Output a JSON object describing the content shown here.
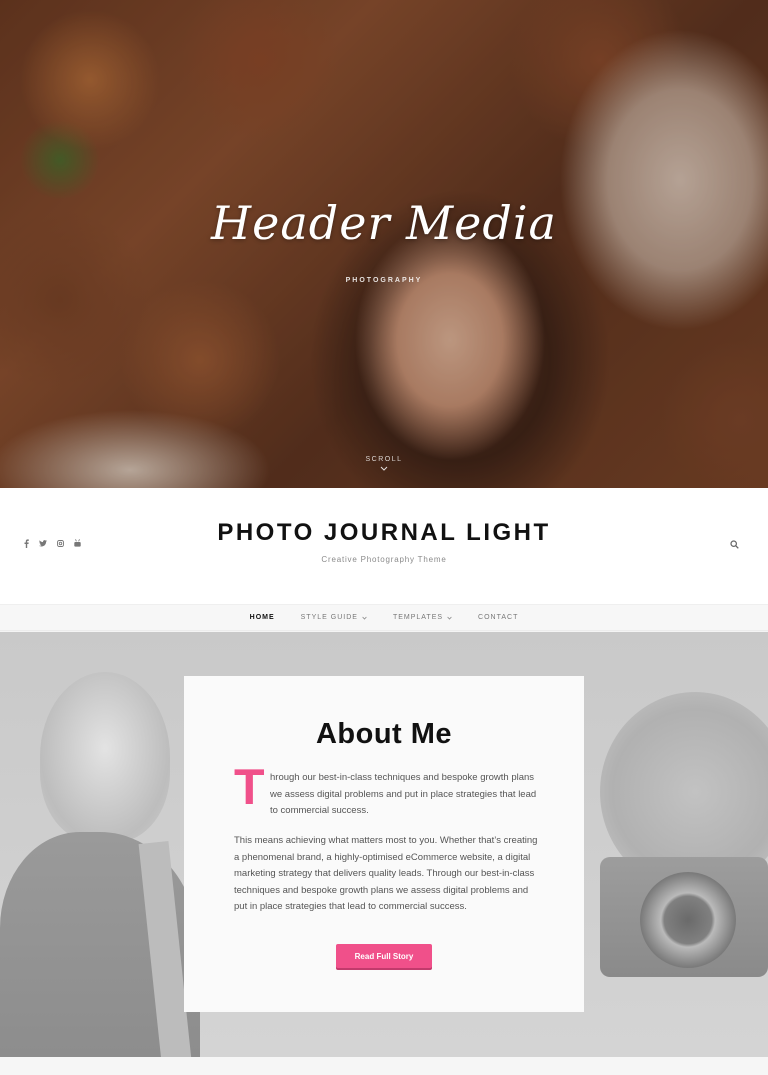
{
  "hero": {
    "title": "Header Media",
    "subtitle": "PHOTOGRAPHY",
    "scroll_label": "SCROLL"
  },
  "site": {
    "title": "PHOTO JOURNAL LIGHT",
    "tagline": "Creative Photography Theme",
    "social_icons": [
      "facebook-icon",
      "twitter-icon",
      "instagram-icon",
      "youtube-icon"
    ]
  },
  "nav": {
    "items": [
      {
        "label": "HOME",
        "active": true,
        "has_dropdown": false
      },
      {
        "label": "STYLE GUIDE",
        "active": false,
        "has_dropdown": true
      },
      {
        "label": "TEMPLATES",
        "active": false,
        "has_dropdown": true
      },
      {
        "label": "CONTACT",
        "active": false,
        "has_dropdown": false
      }
    ]
  },
  "about": {
    "heading": "About Me",
    "dropcap": "T",
    "para1": "hrough our best-in-class techniques and bespoke growth plans we assess digital problems and put in place strategies that lead to commercial success.",
    "para2": "This means achieving what matters most to you. Whether that’s creating a phenomenal brand, a highly-optimised eCommerce website, a digital marketing strategy that delivers quality leads. Through our best-in-class techniques and bespoke growth plans we assess digital problems and put in place strategies that lead to commercial success.",
    "button_label": "Read Full Story"
  },
  "colors": {
    "accent": "#f0508a",
    "title_text": "#111111",
    "body_text": "#555555"
  }
}
